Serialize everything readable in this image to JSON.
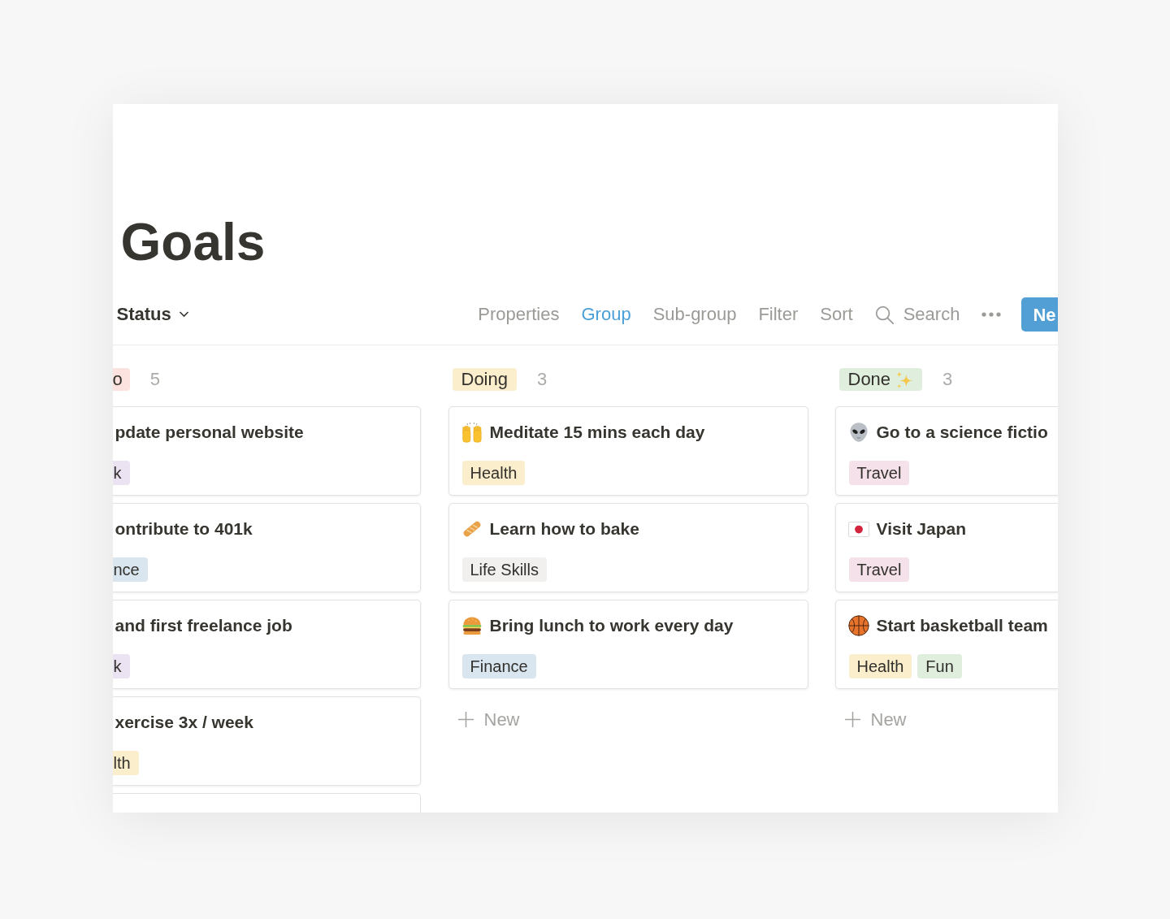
{
  "page": {
    "title": "Goals"
  },
  "toolbar": {
    "view": {
      "label": "Status"
    },
    "actions": [
      {
        "label": "Properties",
        "selected": false
      },
      {
        "label": "Group",
        "selected": true
      },
      {
        "label": "Sub-group",
        "selected": false
      },
      {
        "label": "Filter",
        "selected": false
      },
      {
        "label": "Sort",
        "selected": false
      }
    ],
    "search": {
      "label": "Search"
    },
    "new_button": {
      "label": "Ne"
    }
  },
  "board": {
    "columns": [
      {
        "status": "o",
        "color": "#fde3df",
        "count": "5",
        "more_below": true,
        "cards": [
          {
            "title": "pdate personal website",
            "tags": [
              {
                "label": "k",
                "color": "#ebe3f1"
              }
            ]
          },
          {
            "title": "ontribute to 401k",
            "tags": [
              {
                "label": "nce",
                "color": "#d9e6ef"
              }
            ]
          },
          {
            "title": "and first freelance job",
            "tags": [
              {
                "label": "k",
                "color": "#ebe3f1"
              }
            ]
          },
          {
            "title": "xercise 3x / week",
            "tags": [
              {
                "label": "lth",
                "color": "#fbeecc"
              }
            ]
          }
        ]
      },
      {
        "status": "Doing",
        "color": "#fbeecc",
        "count": "3",
        "add_label": "New",
        "cards": [
          {
            "title": "Meditate 15 mins each day",
            "tags": [
              {
                "label": "Health",
                "color": "#fbeecc"
              }
            ]
          },
          {
            "title": "Learn how to bake",
            "tags": [
              {
                "label": "Life Skills",
                "color": "#f1f0ef"
              }
            ]
          },
          {
            "title": "Bring lunch to work every day",
            "tags": [
              {
                "label": "Finance",
                "color": "#d9e6ef"
              }
            ]
          }
        ]
      },
      {
        "status": "Done",
        "color": "#e0eedd",
        "count": "3",
        "add_label": "New",
        "cards": [
          {
            "title": "Go to a science fictio",
            "tags": [
              {
                "label": "Travel",
                "color": "#f5e1ea"
              }
            ]
          },
          {
            "title": "Visit Japan",
            "tags": [
              {
                "label": "Travel",
                "color": "#f5e1ea"
              }
            ]
          },
          {
            "title": "Start basketball team",
            "tags": [
              {
                "label": "Health",
                "color": "#fbeecc"
              },
              {
                "label": "Fun",
                "color": "#e0eedd"
              }
            ]
          }
        ]
      }
    ]
  }
}
